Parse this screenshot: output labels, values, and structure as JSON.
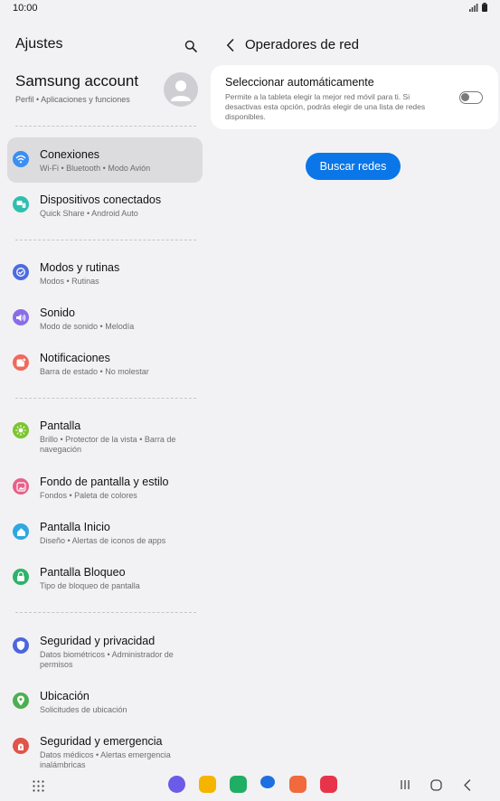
{
  "status_bar": {
    "time": "10:00"
  },
  "left_pane": {
    "title": "Ajustes",
    "account": {
      "name": "Samsung account",
      "sub": "Perfil  •  Aplicaciones y funciones"
    },
    "items": [
      {
        "title": "Conexiones",
        "sub": "Wi-Fi  •  Bluetooth  •  Modo Avión",
        "color": "#3a8ef5"
      },
      {
        "title": "Dispositivos conectados",
        "sub": "Quick Share  •  Android Auto",
        "color": "#2fbfb0"
      },
      {
        "title": "Modos y rutinas",
        "sub": "Modos  •  Rutinas",
        "color": "#4d6be0"
      },
      {
        "title": "Sonido",
        "sub": "Modo de sonido  •  Melodía",
        "color": "#8a6ee8"
      },
      {
        "title": "Notificaciones",
        "sub": "Barra de estado  •  No molestar",
        "color": "#f06a5c"
      },
      {
        "title": "Pantalla",
        "sub": "Brillo  •  Protector de la vista  •  Barra de navegación",
        "color": "#7cc52f"
      },
      {
        "title": "Fondo de pantalla y estilo",
        "sub": "Fondos  •  Paleta de colores",
        "color": "#e8608a"
      },
      {
        "title": "Pantalla Inicio",
        "sub": "Diseño  •  Alertas de iconos de apps",
        "color": "#2fa7e0"
      },
      {
        "title": "Pantalla Bloqueo",
        "sub": "Tipo de bloqueo de pantalla",
        "color": "#2eb36a"
      },
      {
        "title": "Seguridad y privacidad",
        "sub": "Datos biométricos  •  Administrador de permisos",
        "color": "#4d66dd"
      },
      {
        "title": "Ubicación",
        "sub": "Solicitudes de ubicación",
        "color": "#4caf50"
      },
      {
        "title": "Seguridad y emergencia",
        "sub": "Datos médicos  •  Alertas emergencia inalámbricas",
        "color": "#e0544a"
      }
    ]
  },
  "right_pane": {
    "title": "Operadores de red",
    "auto_select": {
      "title": "Seleccionar automáticamente",
      "desc": "Permite a la tableta elegir la mejor red móvil para ti. Si desactivas esta opción, podrás elegir de una lista de redes disponibles.",
      "enabled": false
    },
    "search_button": "Buscar redes"
  },
  "colors": {
    "accent": "#0a76e8",
    "selected_bg": "#dcdcde"
  },
  "dock_apps": [
    {
      "name": "internet-app-icon",
      "color": "#6b5be8"
    },
    {
      "name": "my-files-app-icon",
      "color": "#f5b400"
    },
    {
      "name": "phone-app-icon",
      "color": "#1fae63"
    },
    {
      "name": "messages-app-icon",
      "color": "#1f6fe0"
    },
    {
      "name": "contacts-app-icon",
      "color": "#f06a3c"
    },
    {
      "name": "screen-recorder-app-icon",
      "color": "#e8344a"
    }
  ]
}
